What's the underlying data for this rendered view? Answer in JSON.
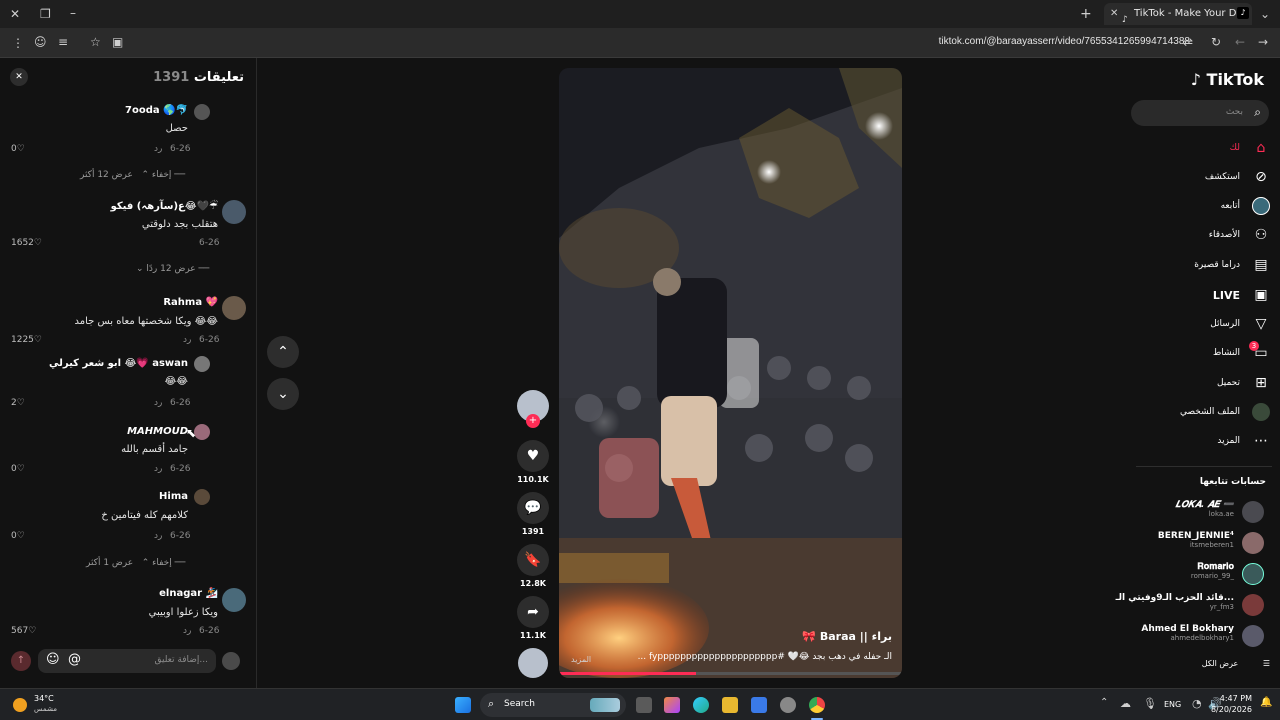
{
  "browser": {
    "tab_title": "TikTok - Make Your Day",
    "url": "tiktok.com/@baraayasserr/video/7655341265994714388",
    "new_tab_label": "+"
  },
  "comments": {
    "title": "تعليقات",
    "count": "1391",
    "items": [
      {
        "name": "7ooda 🌎🐬",
        "text": "حصل",
        "date": "6-26",
        "reply": "رد",
        "likes": "0"
      },
      {
        "name": "ع(سآرهہ) فيكو😂🖤☔",
        "text": "هتقلب بجد دلوقتي",
        "date": "6-26",
        "reply": "",
        "likes": "1652"
      },
      {
        "name": "Rahma 💖",
        "text": "ويكا شخصتها معاه بس جامد 😂😂",
        "date": "6-26",
        "reply": "رد",
        "likes": "1225"
      },
      {
        "name": "ابو شعر كيرلي 😂💗 aswan",
        "text": "😂😂",
        "date": "6-26",
        "reply": "رد",
        "likes": "2"
      },
      {
        "name": "𝙈𝘼𝙃𝙈𝙊𝙐𝘿",
        "text": "جامد أقسم بالله",
        "date": "6-26",
        "reply": "رد",
        "likes": "0"
      },
      {
        "name": "Hima",
        "text": "كلامهم كله فيتامين خ",
        "date": "6-26",
        "reply": "رد",
        "likes": "0"
      },
      {
        "name": "elnagar 🏂",
        "text": "ويكا زعلوا اوبيبي",
        "date": "6-26",
        "reply": "رد",
        "likes": "567"
      }
    ],
    "expand1": {
      "show": "عرض 12 أكثر",
      "hide": "إخفاء"
    },
    "expand2": {
      "show": "عرض 12 ردًا"
    },
    "expand3": {
      "show": "عرض 1 أكثر",
      "hide": "إخفاء"
    },
    "input_placeholder": "إضافة تعليق...",
    "at_symbol": "@"
  },
  "video": {
    "author": "براء || Baraa 🎀",
    "caption": "الـ حفله في دهب بجد 😂🤍 #fyppppppppppppppppppppp ...",
    "more": "المزيد"
  },
  "actions": {
    "likes": "110.1K",
    "comments": "1391",
    "saves": "12.8K",
    "shares": "11.1K"
  },
  "sidebar": {
    "logo": "TikTok",
    "search_placeholder": "بحث",
    "nav": [
      {
        "label": "لك",
        "icon": "home-icon"
      },
      {
        "label": "استكشف",
        "icon": "compass-icon"
      },
      {
        "label": "أتابعه",
        "icon": "following-icon"
      },
      {
        "label": "الأصدقاء",
        "icon": "friends-icon"
      },
      {
        "label": "دراما قصيرة",
        "icon": "drama-icon"
      },
      {
        "label": "LIVE",
        "icon": "live-icon"
      },
      {
        "label": "الرسائل",
        "icon": "messages-icon"
      },
      {
        "label": "النشاط",
        "icon": "activity-icon"
      },
      {
        "label": "تحميل",
        "icon": "upload-icon"
      },
      {
        "label": "الملف الشخصي",
        "icon": "profile-icon"
      },
      {
        "label": "المزيد",
        "icon": "more-icon"
      }
    ],
    "activity_badge": "3",
    "following_title": "حسابات تتابعها",
    "following": [
      {
        "name": "𝑳𝑶𝑲𝑨. 𝑨𝑬 ➖",
        "user": "loka.ae"
      },
      {
        "name": "BEREN_JENNIE⁴",
        "user": "itsmeberen1"
      },
      {
        "name": "𝐑𝐨𝐦𝐚𝐫𝐢𝐨",
        "user": "romario_99_"
      },
      {
        "name": "قائد الحزب الـ9وفيتي الـ...",
        "user": "yr_fm3"
      },
      {
        "name": "Ahmed El Bokhary",
        "user": "ahmedelbokhary1"
      }
    ],
    "show_all": "عرض الكل"
  },
  "taskbar": {
    "weather_temp": "34°C",
    "weather_desc": "مشمس",
    "search": "Search",
    "lang": "ENG",
    "time": "4:47 PM",
    "date": "8/20/2026"
  },
  "colors": {
    "accent": "#fe2c55",
    "bg": "#121212"
  }
}
